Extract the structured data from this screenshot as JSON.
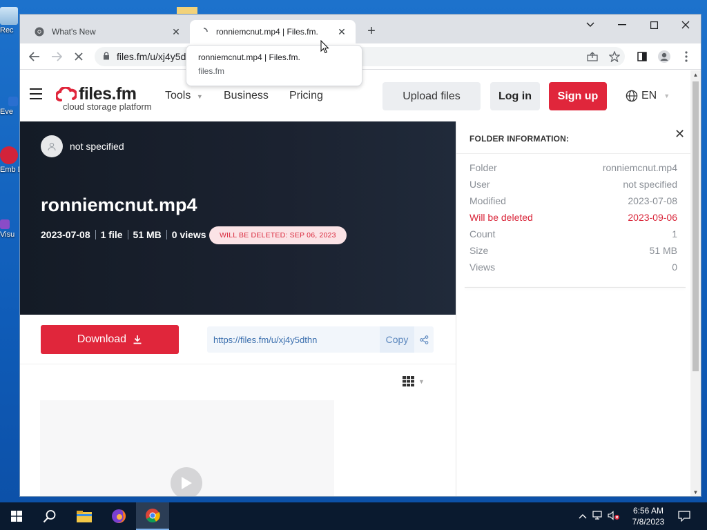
{
  "desktop": {
    "icons": [
      "Rec",
      "Eve",
      "Emb De",
      "Visu"
    ]
  },
  "browser": {
    "tabs": [
      {
        "title": "What's New",
        "active": false
      },
      {
        "title": "ronniemcnut.mp4 | Files.fm.",
        "active": true
      }
    ],
    "new_tab": "+",
    "url": "files.fm/u/xj4y5d",
    "tooltip": {
      "title": "ronniemcnut.mp4 | Files.fm.",
      "domain": "files.fm"
    }
  },
  "site": {
    "logo_text": "files.fm",
    "logo_tagline": "cloud storage platform",
    "nav": [
      "Tools",
      "Business",
      "Pricing"
    ],
    "upload_button": "Upload files",
    "login_button": "Log in",
    "signup_button": "Sign up",
    "language": "EN"
  },
  "hero": {
    "owner": "not specified",
    "title": "ronniemcnut.mp4",
    "date": "2023-07-08",
    "files": "1 file",
    "size": "51 MB",
    "views": "0 views",
    "delete_badge": "WILL BE DELETED: SEP 06, 2023"
  },
  "actions": {
    "download_label": "Download",
    "share_url": "https://files.fm/u/xj4y5dthn",
    "copy_label": "Copy"
  },
  "folder_info": {
    "heading": "FOLDER INFORMATION:",
    "rows": [
      {
        "label": "Folder",
        "value": "ronniemcnut.mp4"
      },
      {
        "label": "User",
        "value": "not specified"
      },
      {
        "label": "Modified",
        "value": "2023-07-08"
      },
      {
        "label": "Will be deleted",
        "value": "2023-09-06"
      },
      {
        "label": "Count",
        "value": "1"
      },
      {
        "label": "Size",
        "value": "51 MB"
      },
      {
        "label": "Views",
        "value": "0"
      }
    ]
  },
  "taskbar": {
    "time": "6:56 AM",
    "date": "7/8/2023"
  },
  "colors": {
    "accent_red": "#e0263b",
    "hero_bg": "#1b2230",
    "link_blue": "#3b6fae"
  }
}
